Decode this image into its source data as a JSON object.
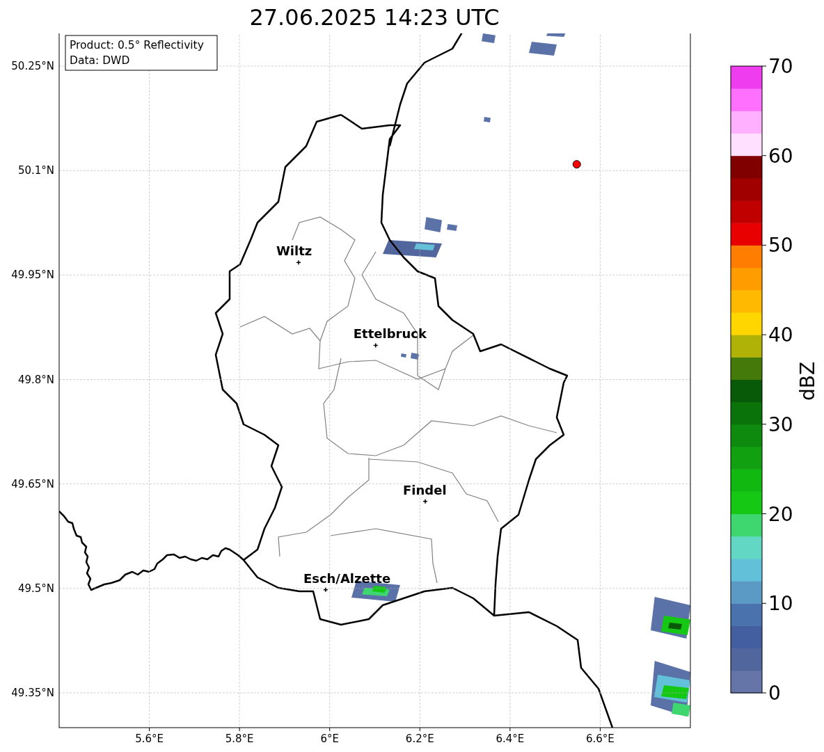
{
  "title": "27.06.2025 14:23 UTC",
  "map": {
    "info_box": [
      "Product: 0.5° Reflectivity",
      "Data: DWD"
    ],
    "chart_data": {
      "type": "scatter",
      "xlim": [
        5.4,
        6.8
      ],
      "ylim": [
        49.3,
        50.3
      ],
      "xticks": [
        {
          "value": 5.6,
          "label": "5.6°E"
        },
        {
          "value": 5.8,
          "label": "5.8°E"
        },
        {
          "value": 6.0,
          "label": "6°E"
        },
        {
          "value": 6.2,
          "label": "6.2°E"
        },
        {
          "value": 6.4,
          "label": "6.4°E"
        },
        {
          "value": 6.6,
          "label": "6.6°E"
        }
      ],
      "yticks": [
        {
          "value": 49.35,
          "label": "49.35°N"
        },
        {
          "value": 49.5,
          "label": "49.5°N"
        },
        {
          "value": 49.65,
          "label": "49.65°N"
        },
        {
          "value": 49.8,
          "label": "49.8°N"
        },
        {
          "value": 49.95,
          "label": "49.95°N"
        },
        {
          "value": 50.1,
          "label": "50.1°N"
        },
        {
          "value": 50.25,
          "label": "50.25°N"
        }
      ],
      "grid": true,
      "series": [
        {
          "color": "#000000",
          "x": [
            5.931,
            6.102,
            6.212,
            5.991
          ],
          "values": [
            49.968,
            49.849,
            49.625,
            49.498
          ]
        },
        {
          "color": "#ff0000",
          "x": [
            6.548
          ],
          "values": [
            50.109
          ]
        }
      ],
      "annotations": [
        {
          "text": "Wiltz",
          "x": 5.931,
          "y": 49.968
        },
        {
          "text": "Ettelbruck",
          "x": 6.102,
          "y": 49.849
        },
        {
          "text": "Findel",
          "x": 6.212,
          "y": 49.625
        },
        {
          "text": "Esch/Alzette",
          "x": 5.991,
          "y": 49.498
        }
      ]
    }
  },
  "colorbar": {
    "label": "dBZ",
    "ticks": [
      "70",
      "60",
      "50",
      "40",
      "30",
      "20",
      "10",
      "0"
    ],
    "bands": [
      {
        "color": "#6675a8"
      },
      {
        "color": "#52669e"
      },
      {
        "color": "#435f9f"
      },
      {
        "color": "#4a72ac"
      },
      {
        "color": "#5a9ac4"
      },
      {
        "color": "#62c0d8"
      },
      {
        "color": "#62d8c4"
      },
      {
        "color": "#3ed66e"
      },
      {
        "color": "#14c814"
      },
      {
        "color": "#10b810"
      },
      {
        "color": "#10a010"
      },
      {
        "color": "#0e8a0e"
      },
      {
        "color": "#0a740a"
      },
      {
        "color": "#085a08"
      },
      {
        "color": "#447a0a"
      },
      {
        "color": "#b0b208"
      },
      {
        "color": "#ffd600"
      },
      {
        "color": "#ffba00"
      },
      {
        "color": "#ff9d00"
      },
      {
        "color": "#ff7d00"
      },
      {
        "color": "#e80000"
      },
      {
        "color": "#c00000"
      },
      {
        "color": "#a00000"
      },
      {
        "color": "#800000"
      },
      {
        "color": "#ffe0ff"
      },
      {
        "color": "#ffb0ff"
      },
      {
        "color": "#ff70ff"
      },
      {
        "color": "#ee3cee"
      }
    ]
  }
}
